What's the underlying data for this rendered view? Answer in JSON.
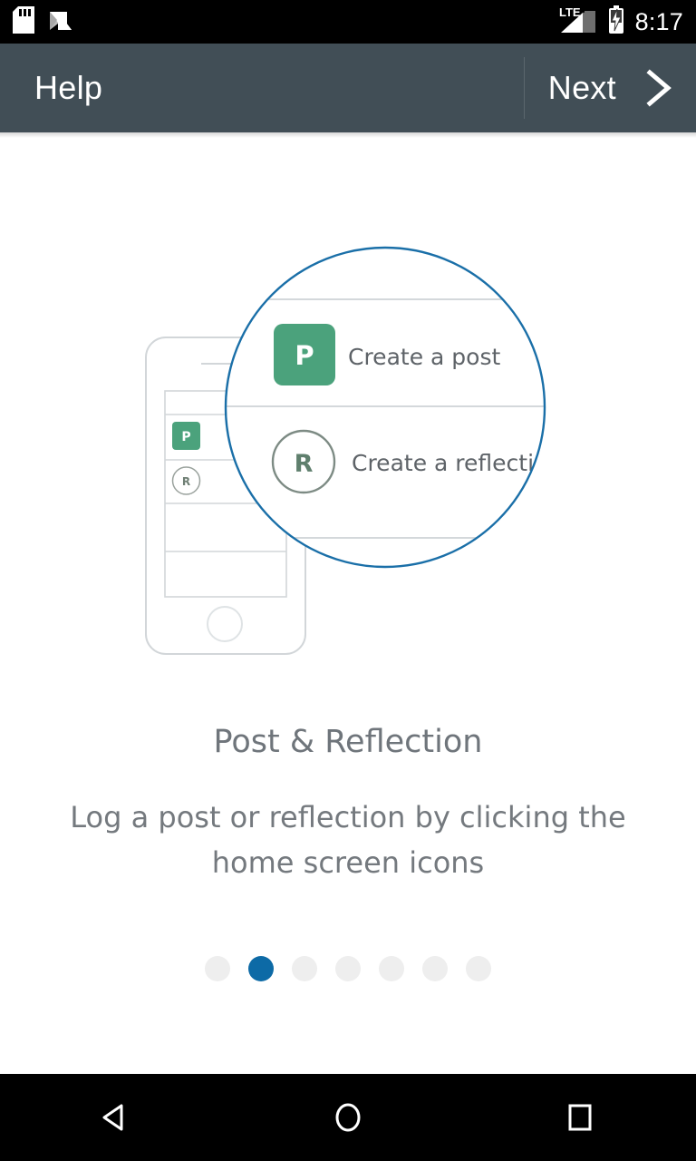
{
  "status_bar": {
    "time": "8:17",
    "network_label": "LTE",
    "icons": [
      "sd-card-icon",
      "android-n-icon",
      "lte-signal-icon",
      "battery-charging-icon"
    ]
  },
  "app_bar": {
    "title": "Help",
    "next_label": "Next",
    "next_icon": "chevron-right-icon"
  },
  "illustration": {
    "phone_label": "phone-mockup",
    "magnifier_label": "magnifier-circle",
    "post_icon_letter": "P",
    "post_row_label": "Create a post",
    "reflection_icon_letter": "R",
    "reflection_row_label": "Create a reflection",
    "mini_post_letter": "P",
    "mini_reflection_letter": "R",
    "colors": {
      "green": "#4ba27c",
      "magnifier_stroke": "#1a6fa8",
      "outline": "#cfd3d6",
      "reflection_stroke": "#7b8a83",
      "reflection_letter": "#5f7f6d"
    }
  },
  "content": {
    "title": "Post & Reflection",
    "subtitle": "Log a post or reflection by clicking the home screen icons"
  },
  "pager": {
    "total": 7,
    "active_index": 1,
    "active_color": "#0d6aa6",
    "inactive_color": "#eeeeee"
  },
  "nav_bar": {
    "back_label": "back-button",
    "home_label": "home-button",
    "recents_label": "recents-button"
  }
}
